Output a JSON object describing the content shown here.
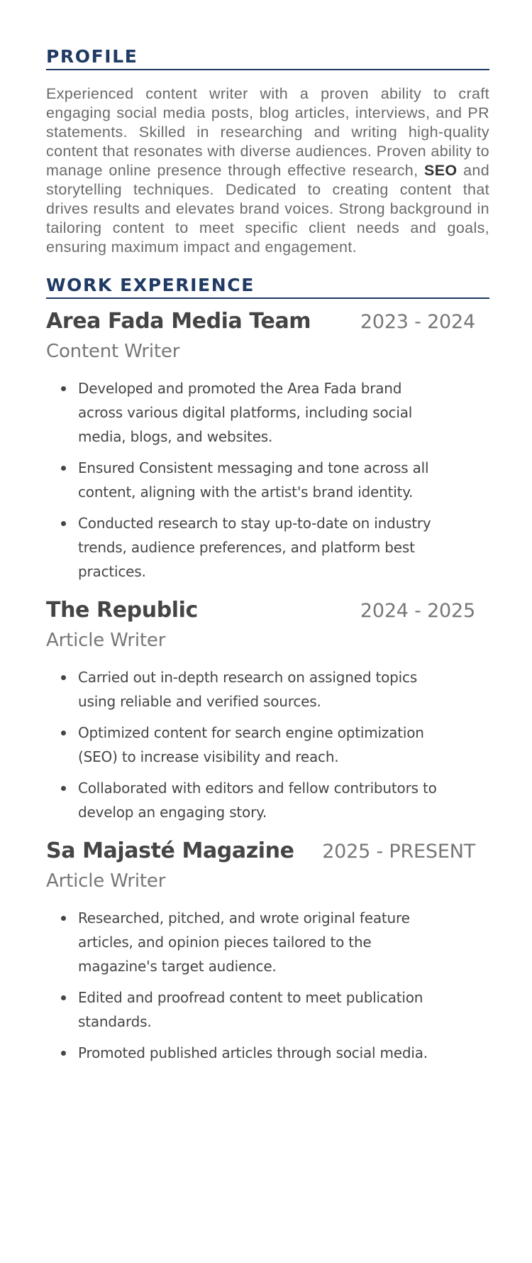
{
  "profile": {
    "heading": "PROFILE",
    "text_before": "Experienced content writer with a proven ability to craft engaging social media posts, blog articles, interviews, and PR statements. Skilled in researching and writing high-quality content that resonates with diverse audiences. Proven ability to manage online presence through effective research, ",
    "highlight": "SEO",
    "text_after": " and storytelling techniques. Dedicated to creating content that drives results and elevates brand voices. Strong background in tailoring content to meet specific client needs and goals, ensuring maximum impact and engagement."
  },
  "work": {
    "heading": "WORK EXPERIENCE",
    "jobs": [
      {
        "company": "Area Fada Media Team",
        "dates": "2023 - 2024",
        "role": "Content Writer",
        "bullets": [
          "Developed and promoted the Area Fada brand across various digital platforms, including social media, blogs, and websites.",
          "Ensured Consistent messaging and tone across all content, aligning with the artist's brand identity.",
          "Conducted research to stay up-to-date on industry trends, audience preferences, and platform best practices."
        ]
      },
      {
        "company": "The Republic",
        "dates": "2024 - 2025",
        "role": "Article Writer",
        "bullets": [
          "Carried out in-depth research on assigned topics using reliable and verified sources.",
          "Optimized content for search engine optimization (SEO) to increase visibility and reach.",
          "Collaborated with editors and fellow contributors to develop an engaging story."
        ]
      },
      {
        "company": "Sa Majasté Magazine",
        "dates": "2025 - PRESENT",
        "role": "Article Writer",
        "bullets": [
          "Researched, pitched, and wrote original feature articles, and opinion pieces tailored to the magazine's target audience.",
          "Edited and proofread content to meet publication standards.",
          "Promoted published articles through social media."
        ]
      }
    ]
  }
}
